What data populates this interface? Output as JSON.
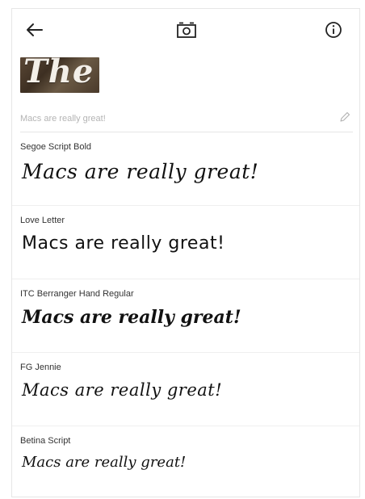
{
  "toolbar": {
    "back_icon": "back-arrow-icon",
    "camera_icon": "camera-icon",
    "info_icon": "info-icon"
  },
  "sample": {
    "text": "The"
  },
  "input": {
    "placeholder": "Macs are really great!",
    "edit_icon": "pencil-icon"
  },
  "fonts": [
    {
      "name": "Segoe Script Bold",
      "preview": "Macs are really great!"
    },
    {
      "name": "Love Letter",
      "preview": "Macs are really great!"
    },
    {
      "name": "ITC Berranger Hand Regular",
      "preview": "Macs are really great!"
    },
    {
      "name": "FG Jennie",
      "preview": "Macs are really great!"
    },
    {
      "name": "Betina Script",
      "preview": "Macs are really great!"
    }
  ]
}
